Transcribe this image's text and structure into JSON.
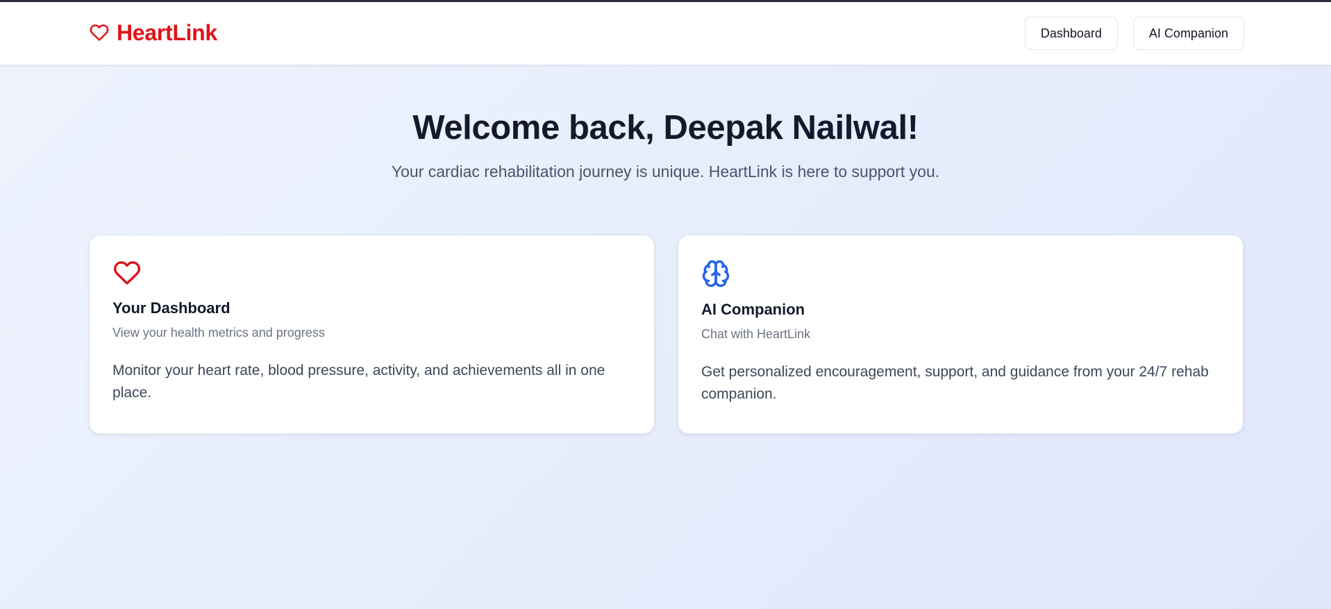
{
  "header": {
    "brand": "HeartLink",
    "nav": [
      {
        "label": "Dashboard"
      },
      {
        "label": "AI Companion"
      }
    ]
  },
  "hero": {
    "title": "Welcome back, Deepak Nailwal!",
    "subtitle": "Your cardiac rehabilitation journey is unique. HeartLink is here to support you."
  },
  "cards": [
    {
      "icon": "heart-icon",
      "title": "Your Dashboard",
      "subtitle": "View your health metrics and progress",
      "description": "Monitor your heart rate, blood pressure, activity, and achievements all in one place."
    },
    {
      "icon": "brain-icon",
      "title": "AI Companion",
      "subtitle": "Chat with HeartLink",
      "description": "Get personalized encouragement, support, and guidance from your 24/7 rehab companion."
    }
  ],
  "colors": {
    "brand_red": "#e0121a",
    "accent_blue": "#2563eb",
    "heading": "#141a2c"
  }
}
